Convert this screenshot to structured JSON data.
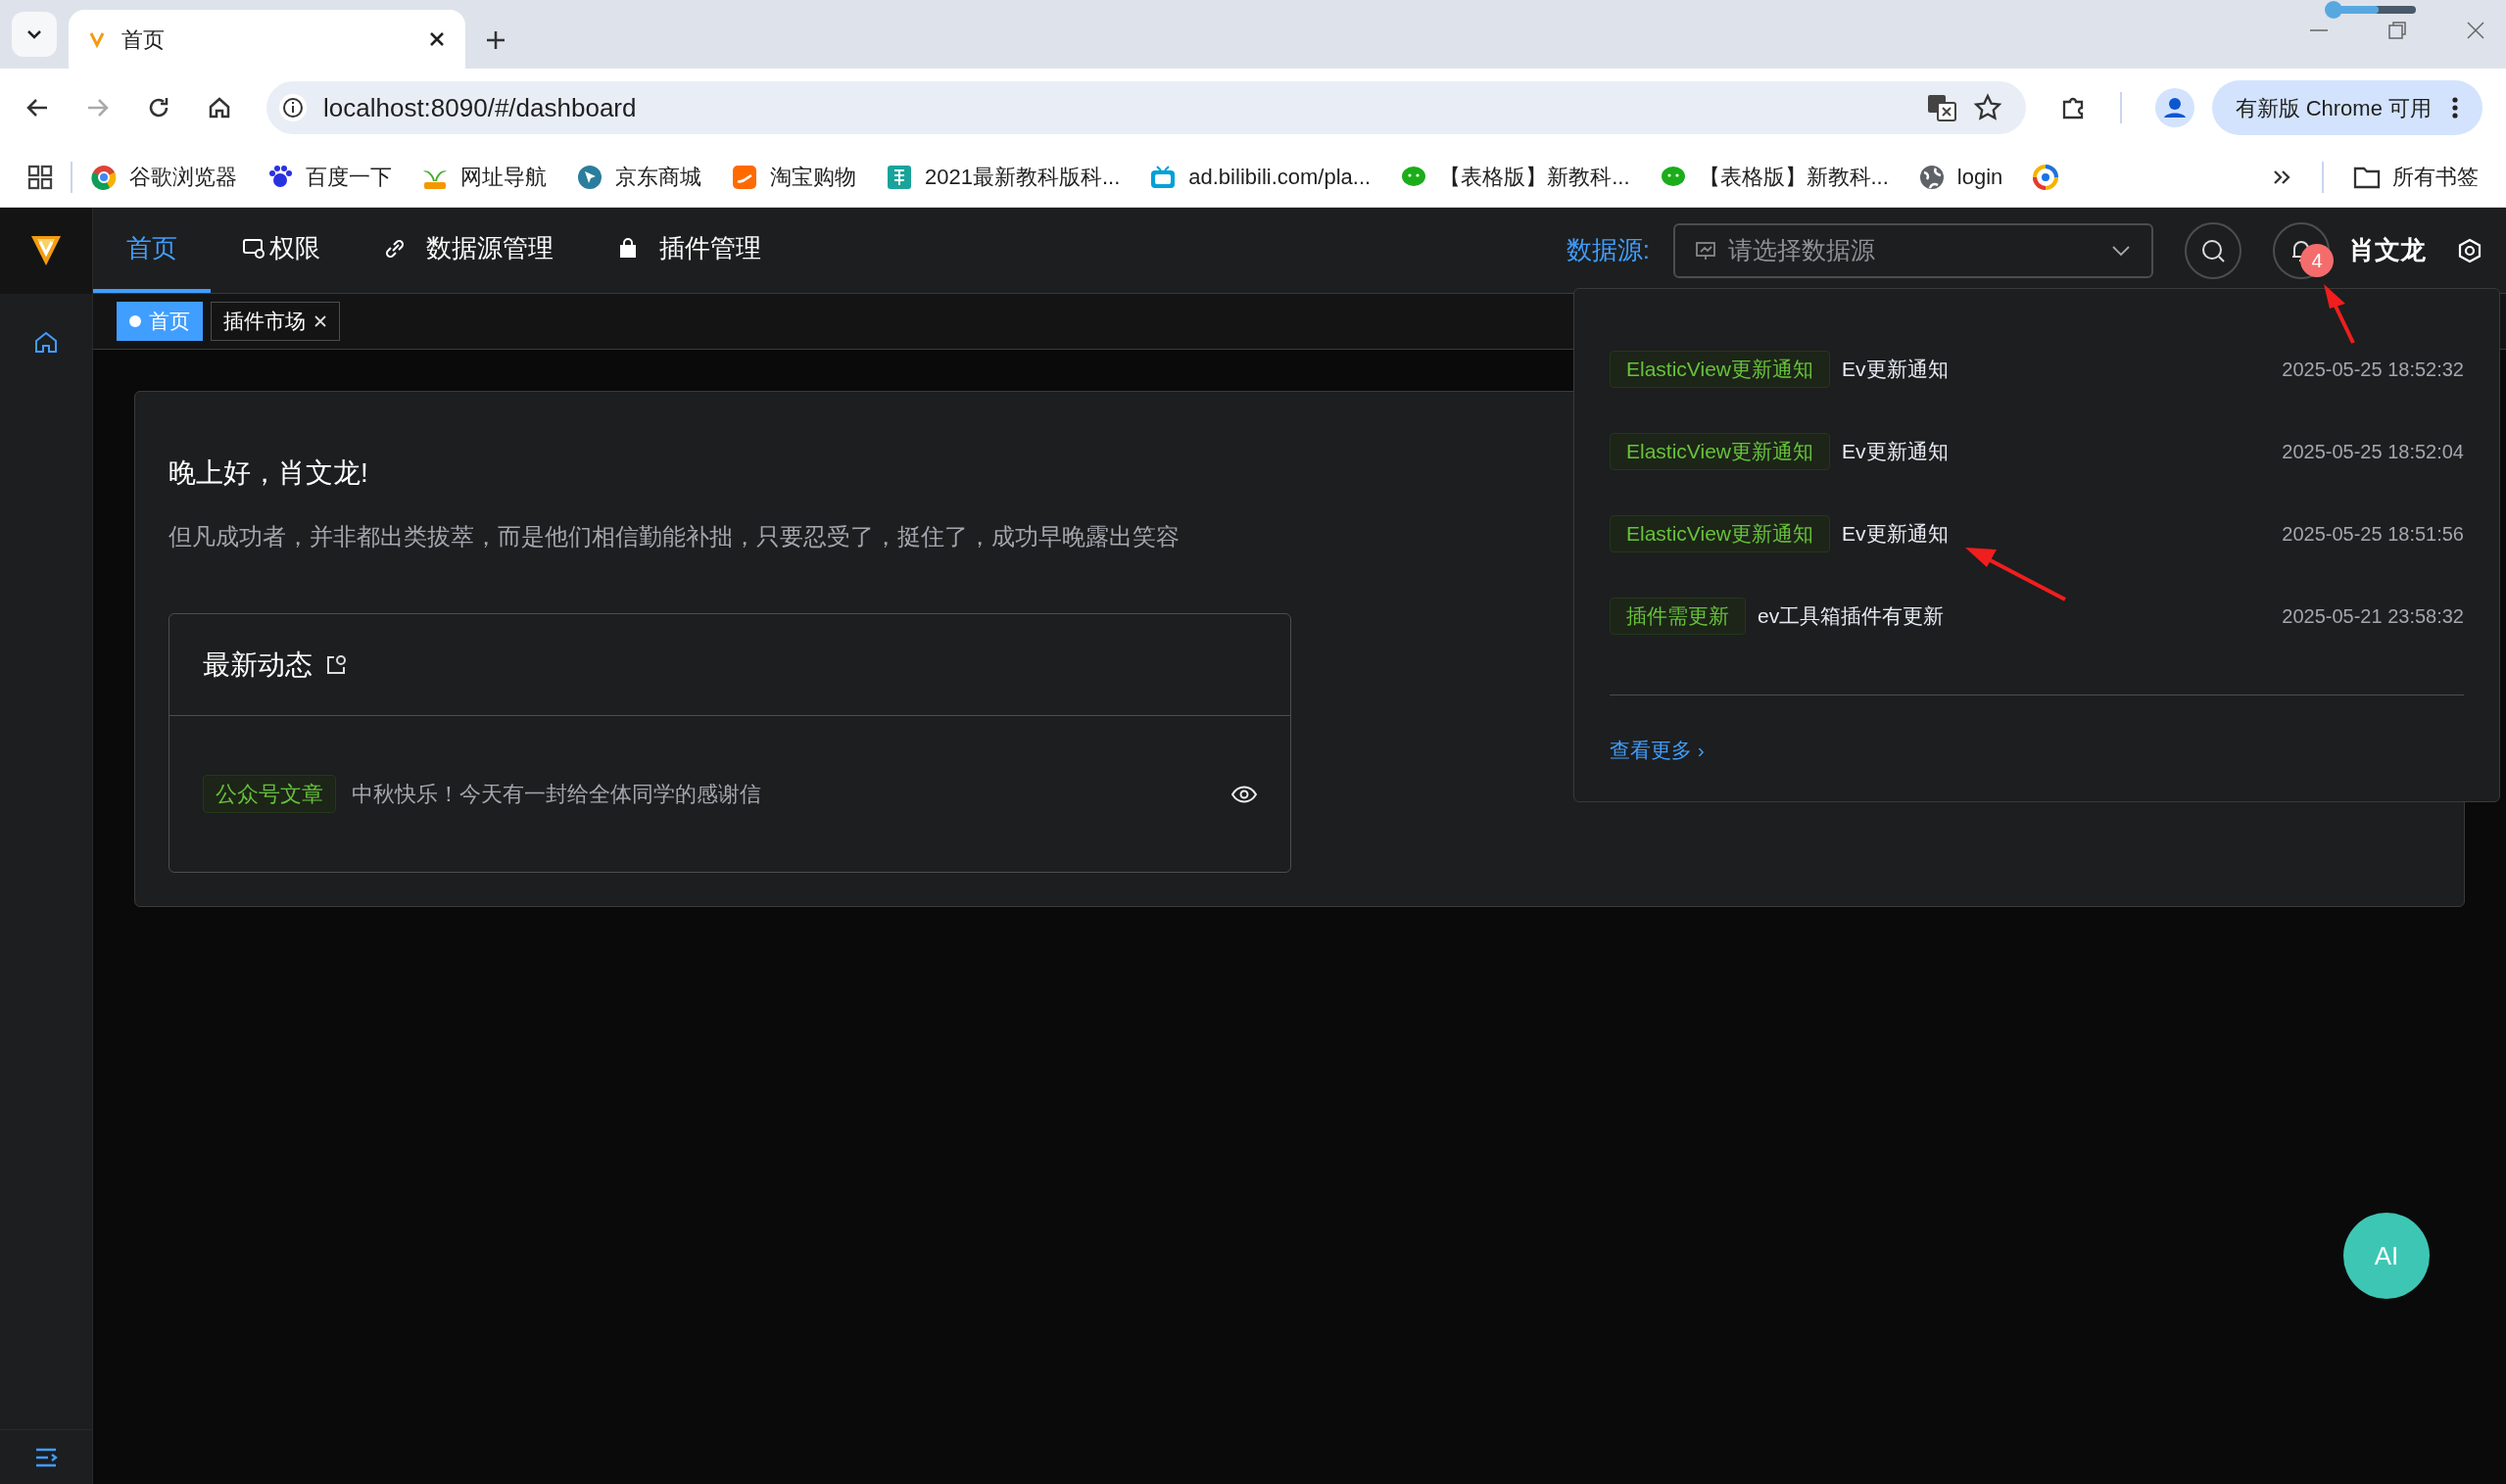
{
  "browser": {
    "tab": {
      "title": "首页"
    },
    "address": "localhost:8090/#/dashboard",
    "update_button": "有新版 Chrome 可用",
    "bookmarks": [
      {
        "label": "谷歌浏览器"
      },
      {
        "label": "百度一下"
      },
      {
        "label": "网址导航"
      },
      {
        "label": "京东商城"
      },
      {
        "label": "淘宝购物"
      },
      {
        "label": "2021最新教科版科..."
      },
      {
        "label": "ad.bilibili.com/pla..."
      },
      {
        "label": "【表格版】新教科..."
      },
      {
        "label": "【表格版】新教科..."
      },
      {
        "label": "login"
      }
    ],
    "all_bookmarks": "所有书签"
  },
  "app": {
    "nav": [
      {
        "label": "首页",
        "selected": true
      },
      {
        "label": "权限",
        "selected": false
      },
      {
        "label": "数据源管理",
        "selected": false
      },
      {
        "label": "插件管理",
        "selected": false
      }
    ],
    "datasource": {
      "label": "数据源:",
      "placeholder": "请选择数据源"
    },
    "notification_count": "4",
    "user": "肖文龙",
    "tabs": [
      {
        "label": "首页",
        "selected": true,
        "closable": false
      },
      {
        "label": "插件市场",
        "selected": false,
        "closable": true
      }
    ],
    "greeting": "晚上好，肖文龙!",
    "quote": "但凡成功者，并非都出类拔萃，而是他们相信勤能补拙，只要忍受了，挺住了，成功早晚露出笑容",
    "news": {
      "title": "最新动态",
      "items": [
        {
          "tag": "公众号文章",
          "text": "中秋快乐！今天有一封给全体同学的感谢信"
        }
      ]
    },
    "notifications": [
      {
        "tag": "ElasticView更新通知",
        "text": "Ev更新通知",
        "time": "2025-05-25 18:52:32"
      },
      {
        "tag": "ElasticView更新通知",
        "text": "Ev更新通知",
        "time": "2025-05-25 18:52:04"
      },
      {
        "tag": "ElasticView更新通知",
        "text": "Ev更新通知",
        "time": "2025-05-25 18:51:56"
      },
      {
        "tag": "插件需更新",
        "text": "ev工具箱插件有更新",
        "time": "2025-05-21 23:58:32"
      }
    ],
    "more_link": "查看更多 ›",
    "ai_button": "AI"
  }
}
